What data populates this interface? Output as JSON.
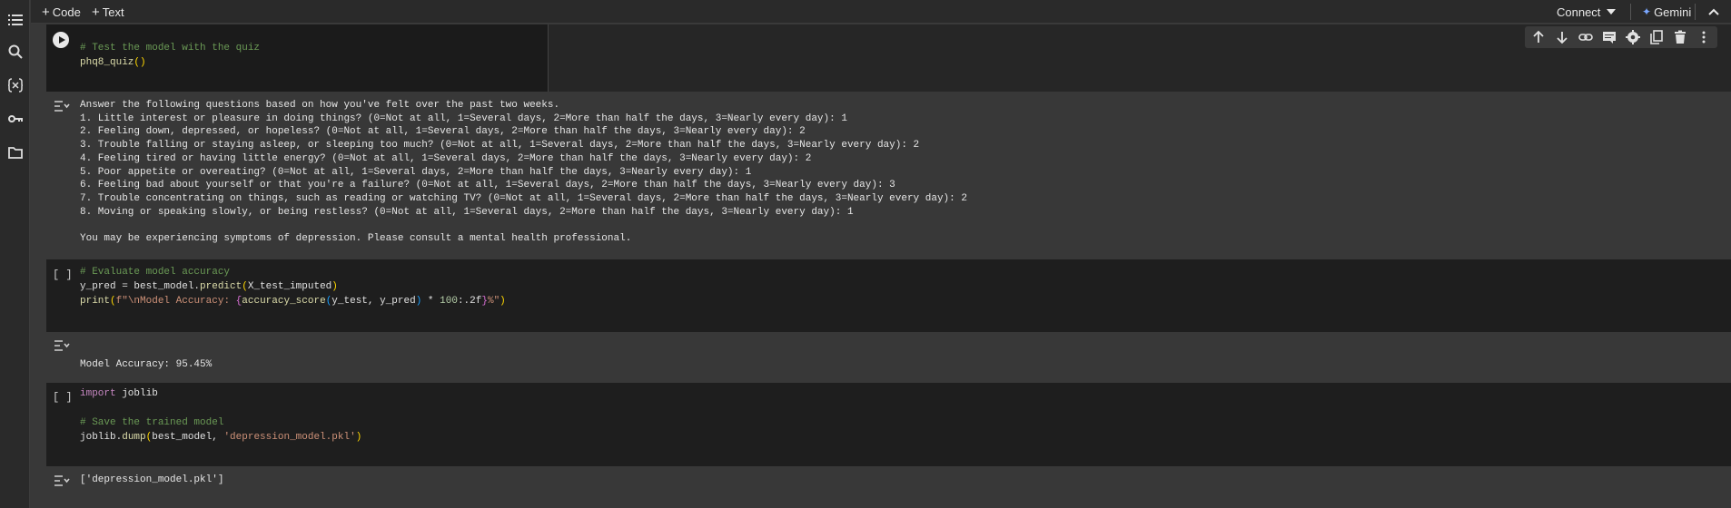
{
  "topbar": {
    "code_label": "Code",
    "text_label": "Text",
    "connect_label": "Connect",
    "gemini_label": "Gemini"
  },
  "icons": {
    "sidebar": [
      "toc-icon",
      "search-icon",
      "variables-icon",
      "key-icon",
      "folder-icon"
    ],
    "toolbar": [
      "arrow-up-icon",
      "arrow-down-icon",
      "link-icon",
      "comment-icon",
      "gear-icon",
      "mirror-cell-icon",
      "trash-icon",
      "more-icon"
    ]
  },
  "cells": [
    {
      "gutter": "",
      "code_lines": [
        "# Test the model with the quiz",
        "phq8_quiz()"
      ],
      "output_lines": [
        "Answer the following questions based on how you've felt over the past two weeks.",
        "1. Little interest or pleasure in doing things? (0=Not at all, 1=Several days, 2=More than half the days, 3=Nearly every day): 1",
        "2. Feeling down, depressed, or hopeless? (0=Not at all, 1=Several days, 2=More than half the days, 3=Nearly every day): 2",
        "3. Trouble falling or staying asleep, or sleeping too much? (0=Not at all, 1=Several days, 2=More than half the days, 3=Nearly every day): 2",
        "4. Feeling tired or having little energy? (0=Not at all, 1=Several days, 2=More than half the days, 3=Nearly every day): 2",
        "5. Poor appetite or overeating? (0=Not at all, 1=Several days, 2=More than half the days, 3=Nearly every day): 1",
        "6. Feeling bad about yourself or that you're a failure? (0=Not at all, 1=Several days, 2=More than half the days, 3=Nearly every day): 3",
        "7. Trouble concentrating on things, such as reading or watching TV? (0=Not at all, 1=Several days, 2=More than half the days, 3=Nearly every day): 2",
        "8. Moving or speaking slowly, or being restless? (0=Not at all, 1=Several days, 2=More than half the days, 3=Nearly every day): 1",
        "",
        "You may be experiencing symptoms of depression. Please consult a mental health professional."
      ]
    },
    {
      "gutter": "[ ]",
      "code_lines": [
        "# Evaluate model accuracy",
        "y_pred = best_model.predict(X_test_imputed)",
        "print(f\"\\nModel Accuracy: {accuracy_score(y_test, y_pred) * 100:.2f}%\")"
      ],
      "output_lines": [
        "",
        "Model Accuracy: 95.45%"
      ]
    },
    {
      "gutter": "[ ]",
      "code_lines": [
        "import joblib",
        "",
        "# Save the trained model",
        "joblib.dump(best_model, 'depression_model.pkl')"
      ],
      "output_lines": [
        "['depression_model.pkl']"
      ]
    }
  ]
}
